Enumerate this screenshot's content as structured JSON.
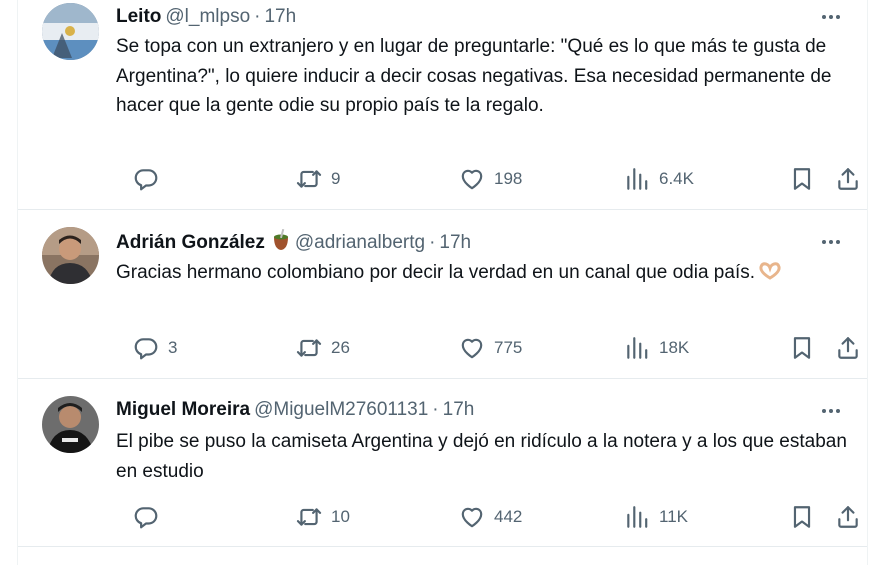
{
  "tweets": [
    {
      "name": "Leito",
      "handle": "@l_mlpso",
      "sep": "·",
      "time": "17h",
      "text": "Se topa con un extranjero y en lugar de preguntarle: \"Qué es lo que más te gusta de Argentina?\",  lo quiere inducir a decir cosas negativas. Esa necesidad permanente de hacer que la gente odie su propio país te la regalo.",
      "reply_count": "",
      "retweet_count": "9",
      "like_count": "198",
      "view_count": "6.4K"
    },
    {
      "name": "Adrián González",
      "handle": "@adrianalbertg",
      "sep": "·",
      "time": "17h",
      "text": "Gracias hermano colombiano por decir la verdad en un canal que odia país.",
      "reply_count": "3",
      "retweet_count": "26",
      "like_count": "775",
      "view_count": "18K"
    },
    {
      "name": "Miguel Moreira",
      "handle": "@MiguelM27601131",
      "sep": "·",
      "time": "17h",
      "text": "El pibe se puso la camiseta Argentina y dejó en ridículo a la notera y a los que estaban en estudio",
      "reply_count": "",
      "retweet_count": "10",
      "like_count": "442",
      "view_count": "11K"
    }
  ],
  "icons": {
    "reply": "reply-icon",
    "retweet": "retweet-icon",
    "like": "heart-icon",
    "views": "views-icon",
    "bookmark": "bookmark-icon",
    "share": "share-icon",
    "more": "more-icon",
    "mate": "mate-emoji-icon",
    "heart_hands": "heart-hands-emoji-icon"
  },
  "colors": {
    "text": "#0f1419",
    "secondary": "#536471",
    "divider": "#eff3f4"
  }
}
